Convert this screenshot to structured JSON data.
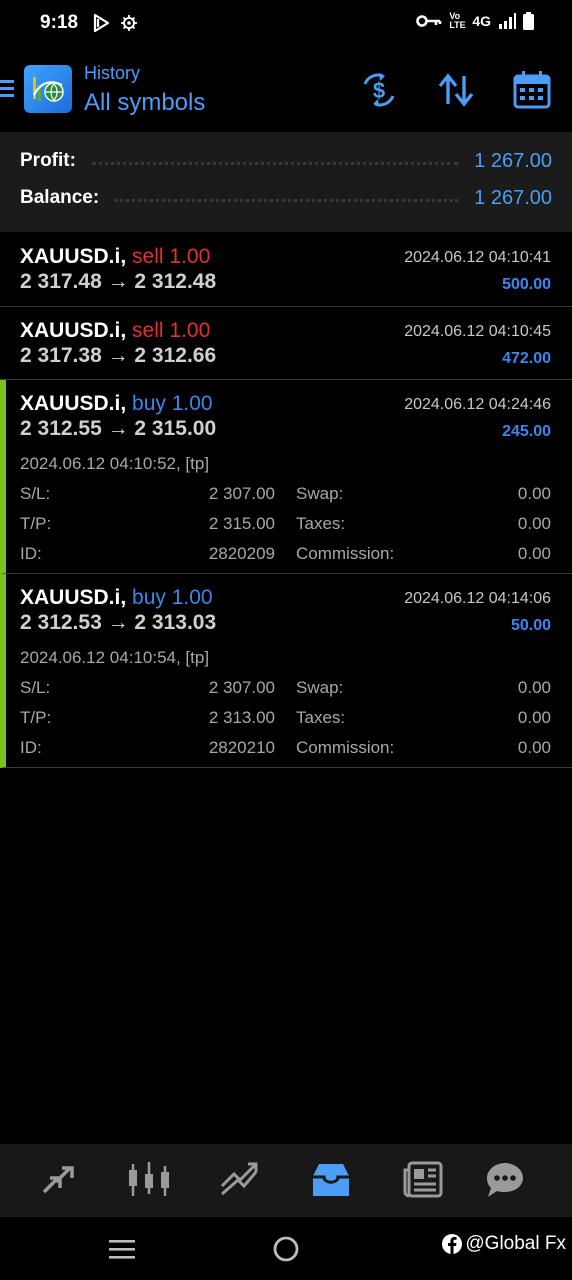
{
  "status_bar": {
    "time": "9:18",
    "network": "4G",
    "volte": "Vo LTE",
    "icons": [
      "play-icon",
      "settings-icon",
      "key-icon",
      "signal-icon",
      "battery-icon"
    ]
  },
  "header": {
    "subtitle": "History",
    "title": "All symbols",
    "actions": [
      "currency-exchange-icon",
      "sort-icon",
      "calendar-icon"
    ]
  },
  "summary": {
    "profit_label": "Profit:",
    "profit_value": "1 267.00",
    "balance_label": "Balance:",
    "balance_value": "1 267.00"
  },
  "trades": [
    {
      "symbol": "XAUUSD.i,",
      "side": "sell 1.00",
      "prices": "2 317.48 → 2 312.48",
      "close_time": "2024.06.12 04:10:41",
      "profit": "500.00"
    },
    {
      "symbol": "XAUUSD.i,",
      "side": "sell 1.00",
      "prices": "2 317.38 → 2 312.66",
      "close_time": "2024.06.12 04:10:45",
      "profit": "472.00"
    },
    {
      "symbol": "XAUUSD.i,",
      "side": "buy 1.00",
      "prices": "2 312.55 → 2 315.00",
      "close_time": "2024.06.12 04:24:46",
      "profit": "245.00",
      "open_info": "2024.06.12 04:10:52,  [tp]",
      "sl_label": "S/L:",
      "sl": "2 307.00",
      "tp_label": "T/P:",
      "tp": "2 315.00",
      "id_label": "ID:",
      "id": "2820209",
      "swap_label": "Swap:",
      "swap": "0.00",
      "taxes_label": "Taxes:",
      "taxes": "0.00",
      "commission_label": "Commission:",
      "commission": "0.00"
    },
    {
      "symbol": "XAUUSD.i,",
      "side": "buy 1.00",
      "prices": "2 312.53 → 2 313.03",
      "close_time": "2024.06.12 04:14:06",
      "profit": "50.00",
      "open_info": "2024.06.12 04:10:54,  [tp]",
      "sl_label": "S/L:",
      "sl": "2 307.00",
      "tp_label": "T/P:",
      "tp": "2 313.00",
      "id_label": "ID:",
      "id": "2820210",
      "swap_label": "Swap:",
      "swap": "0.00",
      "taxes_label": "Taxes:",
      "taxes": "0.00",
      "commission_label": "Commission:",
      "commission": "0.00"
    }
  ],
  "bottom_nav": {
    "items": [
      "quotes-icon",
      "chart-icon",
      "trade-icon",
      "history-icon",
      "news-icon",
      "chat-icon"
    ],
    "active": "history-icon"
  },
  "watermark": "@Global Fx",
  "colors": {
    "accent_blue": "#4d9cf5",
    "sell_red": "#e03232",
    "buy_blue": "#3a87ee",
    "tp_green": "#7cc11f"
  }
}
